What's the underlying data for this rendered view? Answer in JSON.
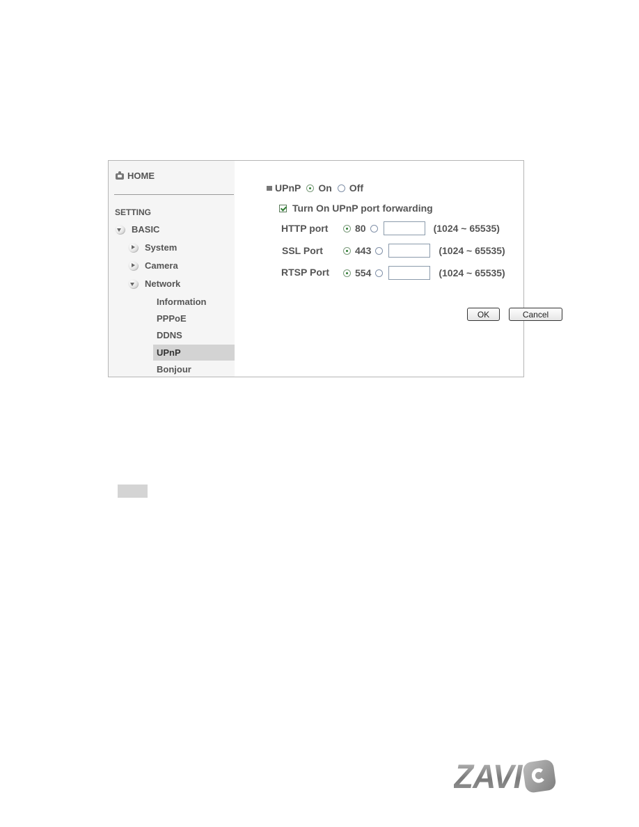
{
  "sidebar": {
    "home_label": "HOME",
    "section_label": "SETTING",
    "basic_label": "BASIC",
    "items": [
      {
        "label": "System",
        "expanded": false
      },
      {
        "label": "Camera",
        "expanded": false
      },
      {
        "label": "Network",
        "expanded": true
      }
    ],
    "network_subitems": [
      {
        "label": "Information",
        "active": false
      },
      {
        "label": "PPPoE",
        "active": false
      },
      {
        "label": "DDNS",
        "active": false
      },
      {
        "label": "UPnP",
        "active": true
      },
      {
        "label": "Bonjour",
        "active": false
      }
    ]
  },
  "upnp": {
    "title": "UPnP",
    "on_label": "On",
    "off_label": "Off",
    "selected": "On",
    "port_forwarding_label": "Turn On UPnP port forwarding",
    "port_forwarding_checked": true,
    "ports": [
      {
        "label": "HTTP port",
        "default": "80",
        "custom_value": "",
        "range": "(1024 ~ 65535)",
        "selected": "default"
      },
      {
        "label": "SSL Port",
        "default": "443",
        "custom_value": "",
        "range": "(1024 ~ 65535)",
        "selected": "default"
      },
      {
        "label": "RTSP Port",
        "default": "554",
        "custom_value": "",
        "range": "(1024 ~ 65535)",
        "selected": "default"
      }
    ],
    "ok_label": "OK",
    "cancel_label": "Cancel"
  },
  "brand": {
    "logo_text": "ZAVI",
    "accent_color": "#2e7d32",
    "active_item_bg": "#d3d3d3"
  }
}
